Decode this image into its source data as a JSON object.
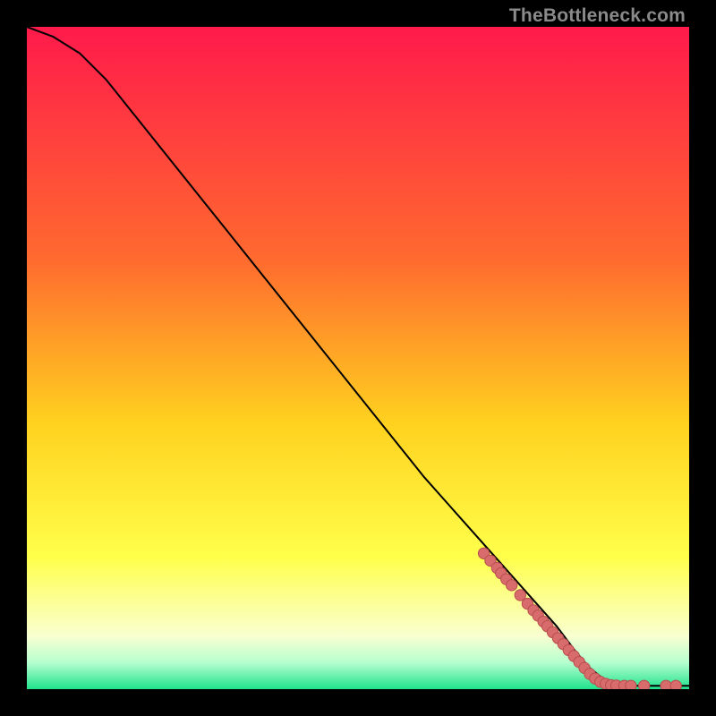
{
  "watermark": "TheBottleneck.com",
  "colors": {
    "bg": "#000000",
    "curve": "#000000",
    "dot_fill": "#d86b6b",
    "dot_stroke": "#b94e4e",
    "grad_top": "#ff1a4b",
    "grad_mid1": "#ff6a2f",
    "grad_mid2": "#ffd21f",
    "grad_mid3": "#ffff4a",
    "grad_mid4": "#f9ffd0",
    "grad_mid5": "#b6ffcf",
    "grad_bot": "#1fe28c"
  },
  "chart_data": {
    "type": "line",
    "title": "",
    "xlabel": "",
    "ylabel": "",
    "xlim": [
      0,
      100
    ],
    "ylim": [
      0,
      100
    ],
    "series": [
      {
        "name": "curve",
        "x": [
          0,
          4,
          8,
          12,
          16,
          20,
          24,
          28,
          32,
          36,
          40,
          44,
          48,
          52,
          56,
          60,
          64,
          68,
          72,
          76,
          80,
          83,
          85,
          88,
          90,
          92,
          94,
          96,
          98,
          100
        ],
        "y": [
          100,
          98.5,
          96,
          92,
          87,
          82,
          77,
          72,
          67,
          62,
          57,
          52,
          47,
          42,
          37,
          32,
          27.5,
          23,
          18.5,
          14,
          9.5,
          5.5,
          3.2,
          0.8,
          0.5,
          0.5,
          0.5,
          0.5,
          0.5,
          0.5
        ]
      }
    ],
    "dots": {
      "name": "highlight-points",
      "points": [
        {
          "x": 69,
          "y": 20.5
        },
        {
          "x": 70,
          "y": 19.4
        },
        {
          "x": 71,
          "y": 18.3
        },
        {
          "x": 71.6,
          "y": 17.5
        },
        {
          "x": 72.4,
          "y": 16.6
        },
        {
          "x": 73.2,
          "y": 15.7
        },
        {
          "x": 74.5,
          "y": 14.2
        },
        {
          "x": 75.6,
          "y": 12.9
        },
        {
          "x": 76.5,
          "y": 11.9
        },
        {
          "x": 77.2,
          "y": 11.1
        },
        {
          "x": 78.0,
          "y": 10.2
        },
        {
          "x": 78.6,
          "y": 9.5
        },
        {
          "x": 79.4,
          "y": 8.6
        },
        {
          "x": 80.2,
          "y": 7.7
        },
        {
          "x": 81.0,
          "y": 6.8
        },
        {
          "x": 81.8,
          "y": 5.9
        },
        {
          "x": 82.6,
          "y": 5.0
        },
        {
          "x": 83.4,
          "y": 4.1
        },
        {
          "x": 84.2,
          "y": 3.2
        },
        {
          "x": 85.0,
          "y": 2.3
        },
        {
          "x": 85.8,
          "y": 1.6
        },
        {
          "x": 86.6,
          "y": 1.1
        },
        {
          "x": 87.4,
          "y": 0.8
        },
        {
          "x": 88.2,
          "y": 0.6
        },
        {
          "x": 89.0,
          "y": 0.55
        },
        {
          "x": 90.2,
          "y": 0.5
        },
        {
          "x": 91.2,
          "y": 0.5
        },
        {
          "x": 93.2,
          "y": 0.5
        },
        {
          "x": 96.5,
          "y": 0.5
        },
        {
          "x": 98.0,
          "y": 0.5
        }
      ]
    }
  }
}
